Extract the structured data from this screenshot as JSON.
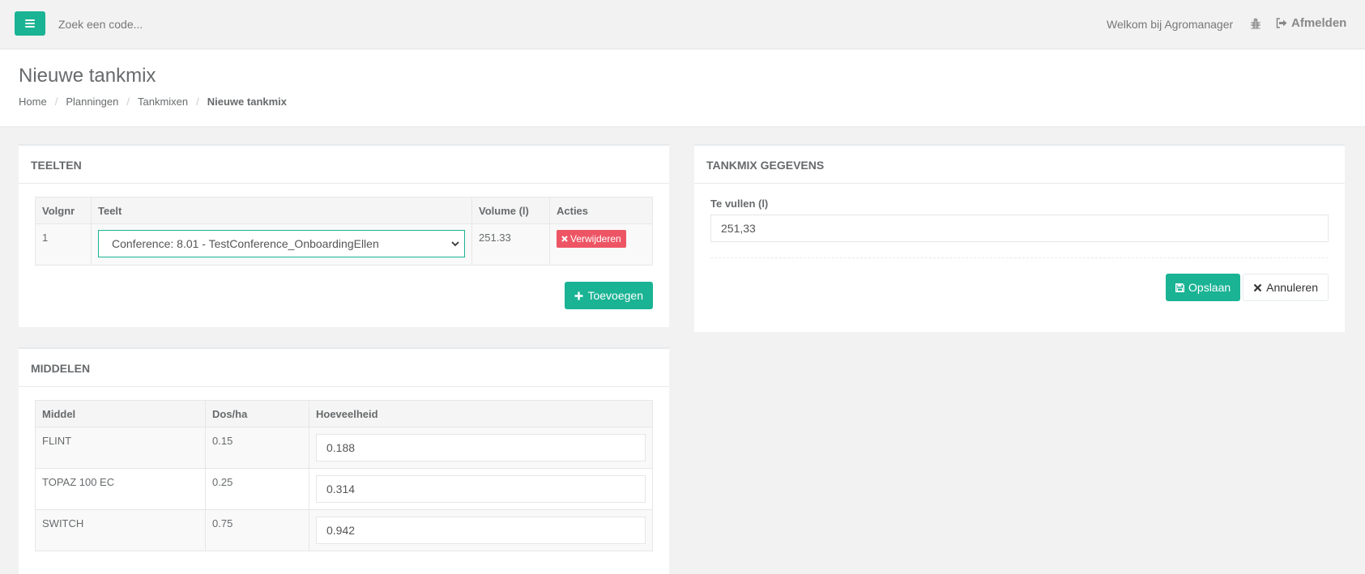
{
  "topbar": {
    "search_placeholder": "Zoek een code...",
    "welcome": "Welkom bij Agromanager",
    "logout": "Afmelden"
  },
  "heading": {
    "title": "Nieuwe tankmix",
    "breadcrumb": [
      "Home",
      "Planningen",
      "Tankmixen",
      "Nieuwe tankmix"
    ]
  },
  "teelten": {
    "title": "TEELTEN",
    "columns": [
      "Volgnr",
      "Teelt",
      "Volume (l)",
      "Acties"
    ],
    "rows": [
      {
        "volgnr": "1",
        "teelt": "Conference: 8.01 - TestConference_OnboardingEllen",
        "volume": "251.33",
        "action": "Verwijderen"
      }
    ],
    "add_button": "Toevoegen"
  },
  "middelen": {
    "title": "MIDDELEN",
    "columns": [
      "Middel",
      "Dos/ha",
      "Hoeveelheid"
    ],
    "rows": [
      {
        "middel": "FLINT",
        "dos": "0.15",
        "hoeveelheid": "0.188"
      },
      {
        "middel": "TOPAZ 100 EC",
        "dos": "0.25",
        "hoeveelheid": "0.314"
      },
      {
        "middel": "SWITCH",
        "dos": "0.75",
        "hoeveelheid": "0.942"
      }
    ]
  },
  "gegevens": {
    "title": "TANKMIX GEGEVENS",
    "te_vullen_label": "Te vullen (l)",
    "te_vullen_value": "251,33",
    "save_button": "Opslaan",
    "cancel_button": "Annuleren"
  },
  "colors": {
    "primary": "#1ab394",
    "danger": "#ed5565"
  },
  "icons": [
    "menu-icon",
    "bug-icon",
    "sign-out-icon",
    "chevron-down-icon",
    "times-icon",
    "plus-icon",
    "save-icon"
  ]
}
